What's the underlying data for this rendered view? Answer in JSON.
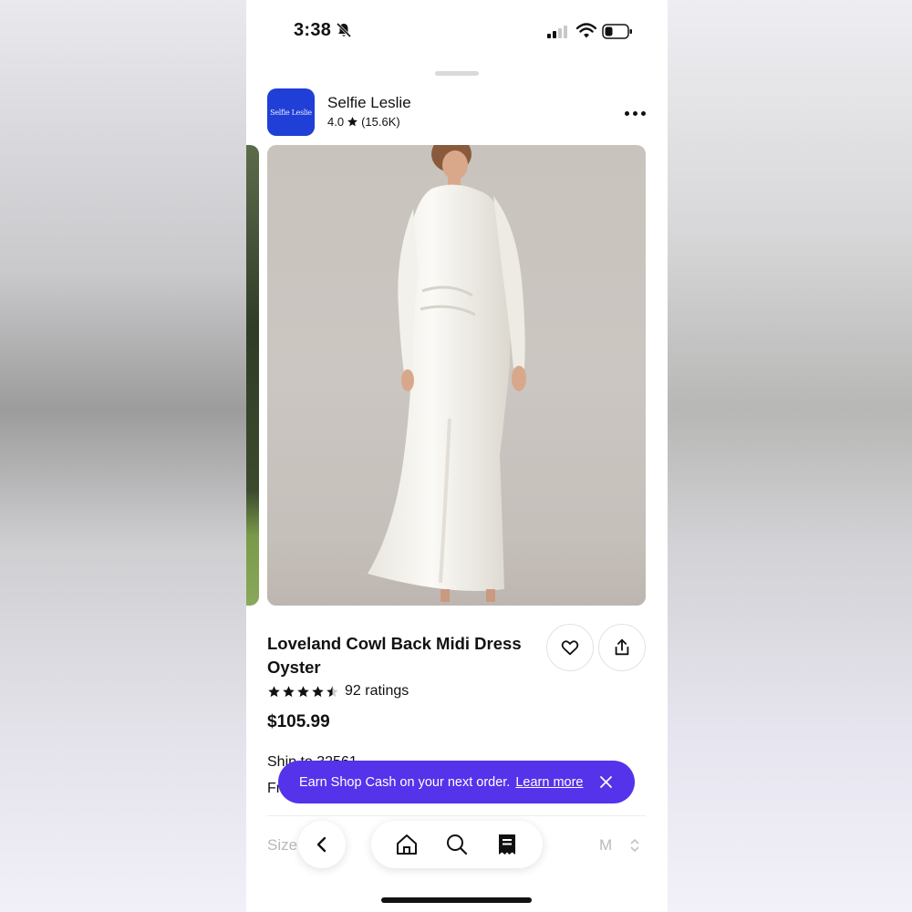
{
  "status_bar": {
    "time": "3:38",
    "icons": [
      "bell-off-icon",
      "signal-icon",
      "wifi-icon",
      "battery-icon"
    ]
  },
  "store": {
    "logo_text": "Selfie Leslie",
    "name": "Selfie Leslie",
    "rating": "4.0",
    "review_count": "(15.6K)",
    "logo_color": "#1f3fd6"
  },
  "product": {
    "title": "Loveland Cowl Back Midi Dress Oyster",
    "rating_value": 4.5,
    "ratings_label": "92 ratings",
    "price": "$105.99",
    "ship_to": "Ship to 32561 ⌄",
    "shipping_partial": "Fr"
  },
  "toast": {
    "message": "Earn Shop Cash on your next order.",
    "link": "Learn more",
    "color": "#5433eb"
  },
  "size": {
    "label": "Size",
    "value": "M"
  },
  "nav": {
    "items": [
      "back-icon",
      "home-icon",
      "search-icon",
      "orders-icon"
    ]
  }
}
